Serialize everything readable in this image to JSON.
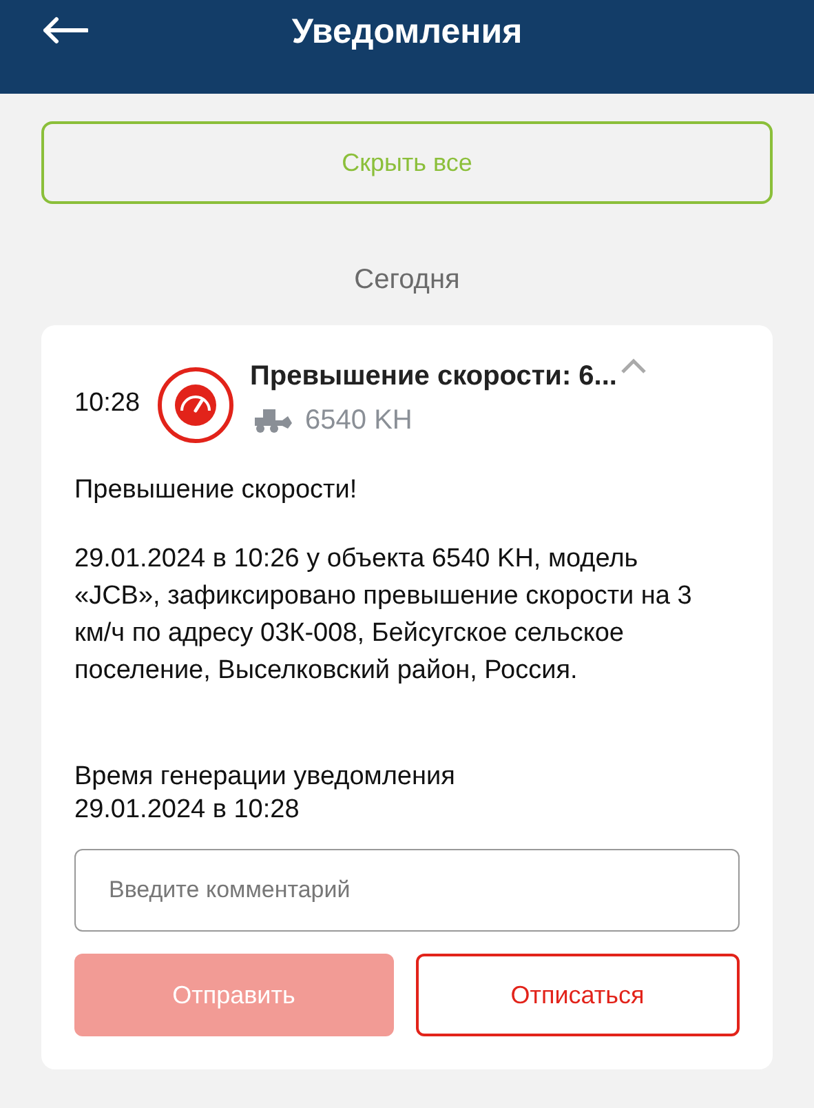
{
  "header": {
    "title": "Уведомления"
  },
  "hide_all_button": {
    "label": "Скрыть все"
  },
  "date_group": "Сегодня",
  "notification": {
    "time": "10:28",
    "title": "Превышение скорости: 6...",
    "object": "6540 KH",
    "expanded": true,
    "heading": "Превышение скорости!",
    "body": "29.01.2024 в 10:26 у объекта 6540 KH, модель «JCB», зафиксировано превышение скорости на 3 км/ч по адресу 03К-008, Бейсугское сельское поселение, Выселковский район, Россия.",
    "generated_label": "Время генерации уведомления",
    "generated_time": "29.01.2024 в 10:28",
    "comment": {
      "placeholder": "Введите комментарий"
    },
    "send_button": {
      "label": "Отправить",
      "disabled": true
    },
    "unsubscribe_button": {
      "label": "Отписаться"
    }
  }
}
